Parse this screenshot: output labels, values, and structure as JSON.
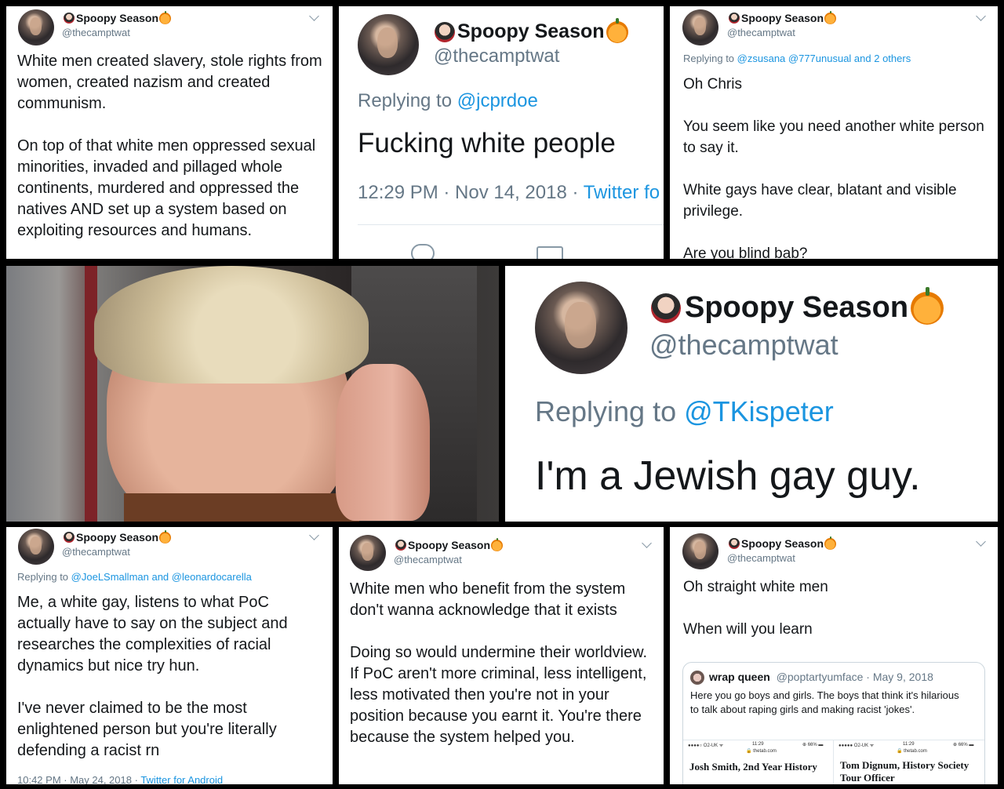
{
  "panel1": {
    "name": "Spoopy Season",
    "handle": "@thecamptwat",
    "body": "White men created slavery, stole rights from women, created nazism and created communism.\n\nOn top of that white men oppressed sexual minorities, invaded and pillaged whole continents, murdered and oppressed the natives AND set up a system based on exploiting resources and humans."
  },
  "panel2": {
    "name": "Spoopy Season",
    "handle": "@thecamptwat",
    "reply_prefix": "Replying to",
    "reply_to": "@jcprdoe",
    "body": "Fucking white people",
    "time": "12:29 PM · Nov 14, 2018 ·",
    "source": "Twitter fo"
  },
  "panel3": {
    "name": "Spoopy Season",
    "handle": "@thecamptwat",
    "reply_prefix": "Replying to",
    "reply_to": "@zsusana @777unusual and 2 others",
    "body": "Oh Chris\n\nYou seem like you need another white person to say it.\n\nWhite gays have clear, blatant and visible privilege.\n\nAre you blind bab?"
  },
  "panel4": {
    "name": "Spoopy Season",
    "handle": "@thecamptwat",
    "reply_prefix": "Replying to",
    "reply_to": "@TKispeter",
    "body": "I'm a Jewish gay guy."
  },
  "panel5": {
    "name": "Spoopy Season",
    "handle": "@thecamptwat",
    "reply_prefix": "Replying to",
    "reply_to": "@JoeLSmallman and @leonardocarella",
    "body": "Me, a white gay, listens to what PoC actually have to say on the subject and researches the complexities of racial dynamics but nice try hun.\n\nI've never claimed to be the most enlightened person but you're literally defending a racist rn",
    "time": "10:42 PM · May 24, 2018 ·",
    "source": "Twitter for Android"
  },
  "panel6": {
    "name": "Spoopy Season",
    "handle": "@thecamptwat",
    "body": "White men who benefit from the system don't wanna acknowledge that it exists\n\nDoing so would undermine their worldview. If PoC aren't more criminal, less intelligent, less motivated then you're not in your position because you earnt it. You're there because the system helped you."
  },
  "panel7": {
    "name": "Spoopy Season",
    "handle": "@thecamptwat",
    "body": "Oh straight white men\n\nWhen will you learn",
    "quote": {
      "name": "wrap queen",
      "handle": "@poptartyumface · May 9, 2018",
      "body": "Here you go boys and girls. The boys that think it's hilarious to talk about raping girls and making racist 'jokes'.",
      "left": {
        "carrier": "●●●●○ O2-UK ᯤ",
        "clock": "11:29",
        "battery": "⊕ 66% ▬",
        "url": "🔒 thetab.com",
        "headline": "Josh Smith, 2nd Year History"
      },
      "right": {
        "carrier": "●●●●● O2-UK ᯤ",
        "clock": "11:29",
        "battery": "⊕ 66% ▬",
        "url": "🔒 thetab.com",
        "headline": "Tom Dignum, History Society\nTour Officer"
      }
    }
  },
  "colors": {
    "link": "#1b95e0",
    "muted": "#657786",
    "text": "#14171a"
  }
}
